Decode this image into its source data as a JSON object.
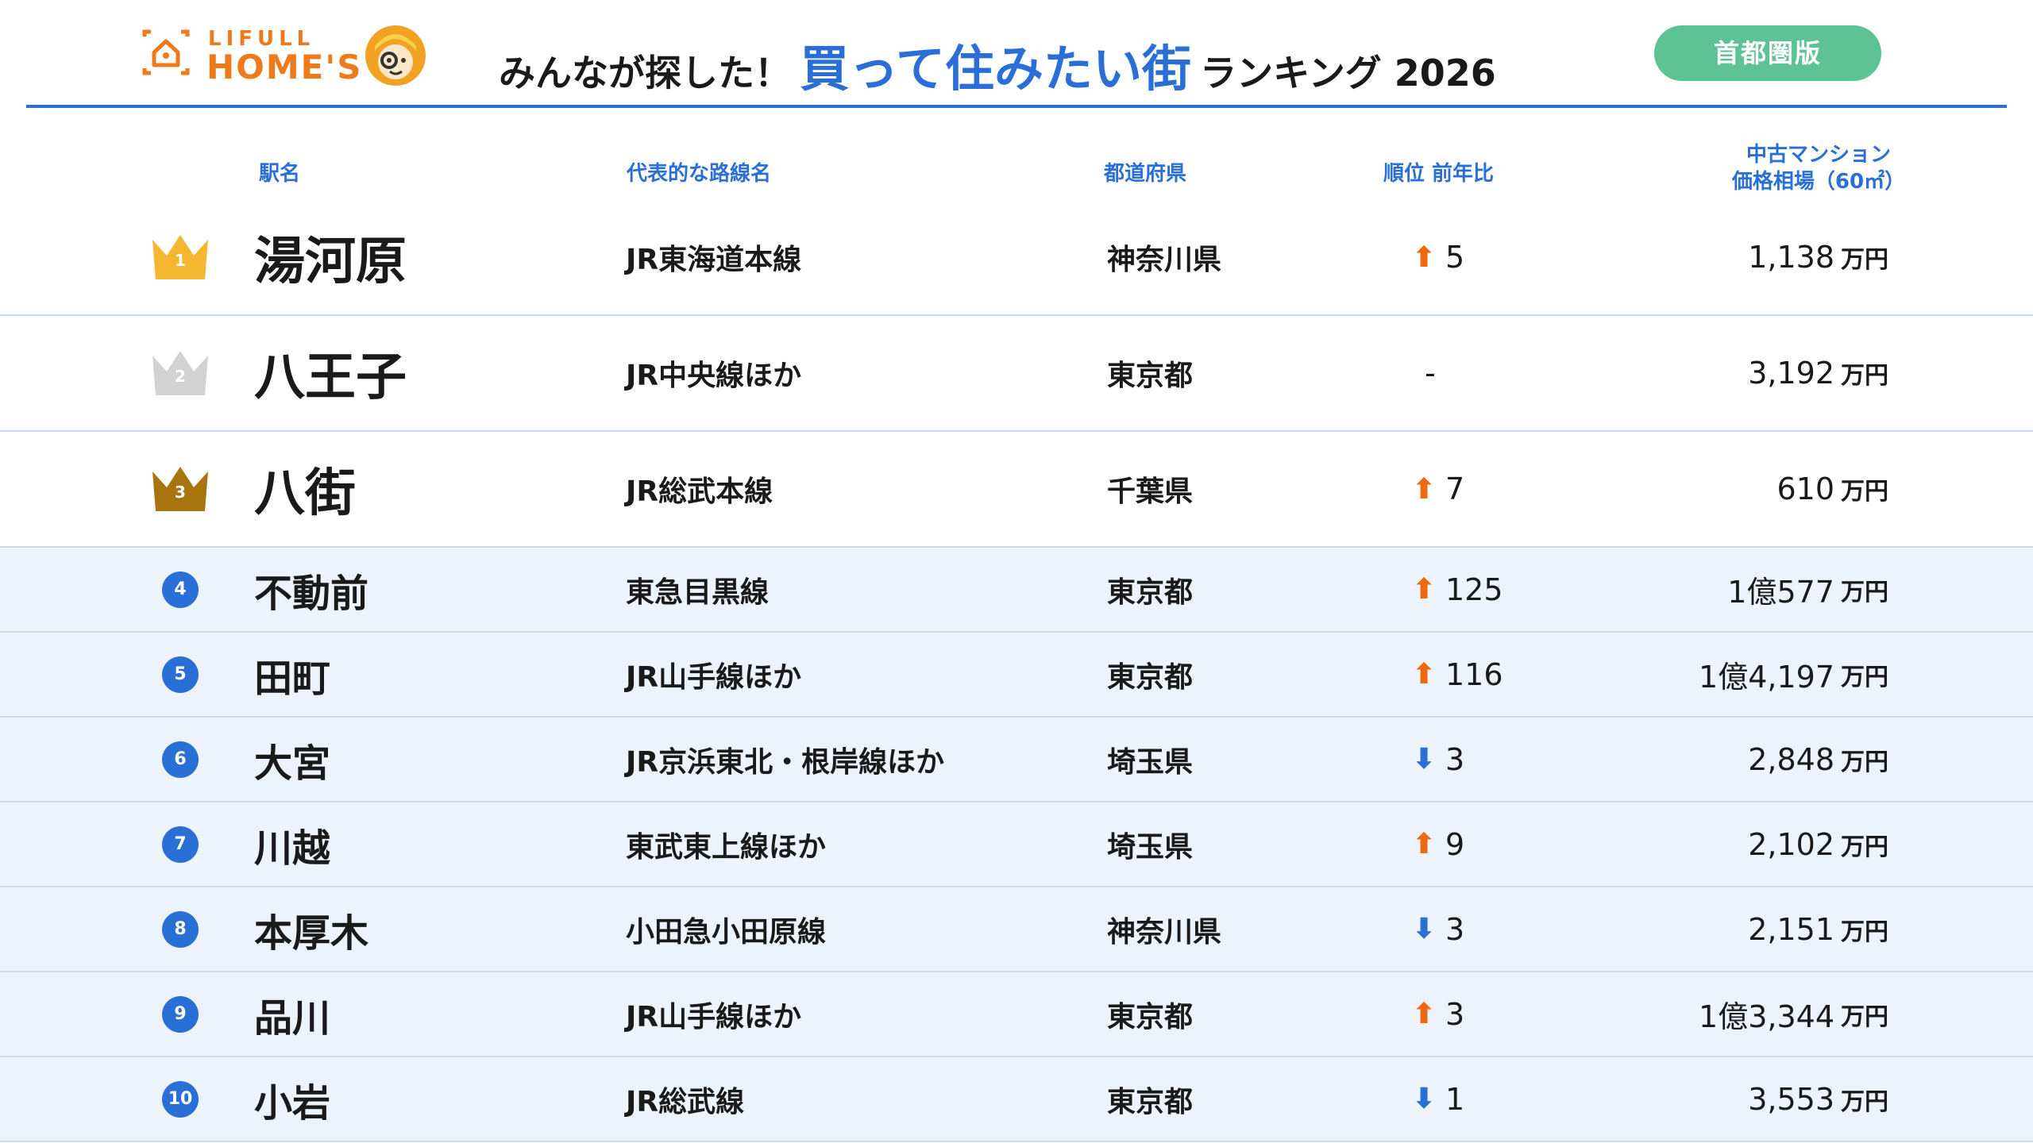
{
  "header": {
    "logo_top": "LIFULL",
    "logo_bottom": "HOME'S",
    "title_pre": "みんなが探した！",
    "title_main": "買って住みたい街",
    "title_post": "ランキング 2026",
    "badge": "首都圏版"
  },
  "columns": {
    "station": "駅名",
    "line": "代表的な路線名",
    "pref": "都道府県",
    "rank_change": "順位 前年比",
    "price_line1": "中古マンション",
    "price_line2": "価格相場（60㎡）"
  },
  "colors": {
    "accent": "#2a6fd6",
    "up_arrow": "#ee6a12",
    "down_arrow": "#2a6fd6",
    "badge_green": "#5ec394",
    "gold": "#f5b731",
    "silver": "#d2d2d2",
    "bronze": "#a8740e",
    "row_tint": "#edf3fb"
  },
  "rows": [
    {
      "rank": "1",
      "station": "湯河原",
      "line": "JR東海道本線",
      "pref": "神奈川県",
      "direction": "up",
      "change": "5",
      "price": "1,138",
      "unit": "万円"
    },
    {
      "rank": "2",
      "station": "八王子",
      "line": "JR中央線ほか",
      "pref": "東京都",
      "direction": "none",
      "change": "-",
      "price": "3,192",
      "unit": "万円"
    },
    {
      "rank": "3",
      "station": "八街",
      "line": "JR総武本線",
      "pref": "千葉県",
      "direction": "up",
      "change": "7",
      "price": "610",
      "unit": "万円"
    },
    {
      "rank": "4",
      "station": "不動前",
      "line": "東急目黒線",
      "pref": "東京都",
      "direction": "up",
      "change": "125",
      "price": "1億577",
      "unit": "万円"
    },
    {
      "rank": "5",
      "station": "田町",
      "line": "JR山手線ほか",
      "pref": "東京都",
      "direction": "up",
      "change": "116",
      "price": "1億4,197",
      "unit": "万円"
    },
    {
      "rank": "6",
      "station": "大宮",
      "line": "JR京浜東北・根岸線ほか",
      "pref": "埼玉県",
      "direction": "down",
      "change": "3",
      "price": "2,848",
      "unit": "万円"
    },
    {
      "rank": "7",
      "station": "川越",
      "line": "東武東上線ほか",
      "pref": "埼玉県",
      "direction": "up",
      "change": "9",
      "price": "2,102",
      "unit": "万円"
    },
    {
      "rank": "8",
      "station": "本厚木",
      "line": "小田急小田原線",
      "pref": "神奈川県",
      "direction": "down",
      "change": "3",
      "price": "2,151",
      "unit": "万円"
    },
    {
      "rank": "9",
      "station": "品川",
      "line": "JR山手線ほか",
      "pref": "東京都",
      "direction": "up",
      "change": "3",
      "price": "1億3,344",
      "unit": "万円"
    },
    {
      "rank": "10",
      "station": "小岩",
      "line": "JR総武線",
      "pref": "東京都",
      "direction": "down",
      "change": "1",
      "price": "3,553",
      "unit": "万円"
    }
  ]
}
